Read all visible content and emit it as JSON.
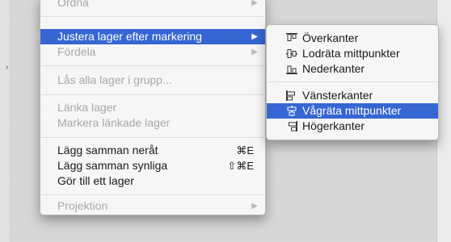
{
  "main_menu": {
    "items": [
      {
        "label": "Ordna",
        "enabled": false,
        "submenu": true
      },
      {
        "label": "Justera lager efter markering",
        "enabled": true,
        "selected": true,
        "submenu": true
      },
      {
        "label": "Fördela",
        "enabled": false,
        "submenu": true
      },
      {
        "label": "Lås alla lager i grupp...",
        "enabled": false
      },
      {
        "label": "Länka lager",
        "enabled": false
      },
      {
        "label": "Markera länkade lager",
        "enabled": false
      },
      {
        "label": "Lägg samman neråt",
        "enabled": true,
        "shortcut": "⌘E"
      },
      {
        "label": "Lägg samman synliga",
        "enabled": true,
        "shortcut": "⇧⌘E"
      },
      {
        "label": "Gör till ett lager",
        "enabled": true
      },
      {
        "label": "Projektion",
        "enabled": false,
        "submenu": true
      }
    ]
  },
  "sub_menu": {
    "items": [
      {
        "label": "Överkanter",
        "icon": "align-top-edges-icon"
      },
      {
        "label": "Lodräta mittpunkter",
        "icon": "align-vertical-centers-icon"
      },
      {
        "label": "Nederkanter",
        "icon": "align-bottom-edges-icon"
      },
      {
        "label": "Vänsterkanter",
        "icon": "align-left-edges-icon"
      },
      {
        "label": "Vågräta mittpunkter",
        "icon": "align-horizontal-centers-icon",
        "selected": true
      },
      {
        "label": "Högerkanter",
        "icon": "align-right-edges-icon"
      }
    ]
  },
  "colors": {
    "highlight": "#3566d2",
    "disabled_text": "#a8a8a8"
  }
}
